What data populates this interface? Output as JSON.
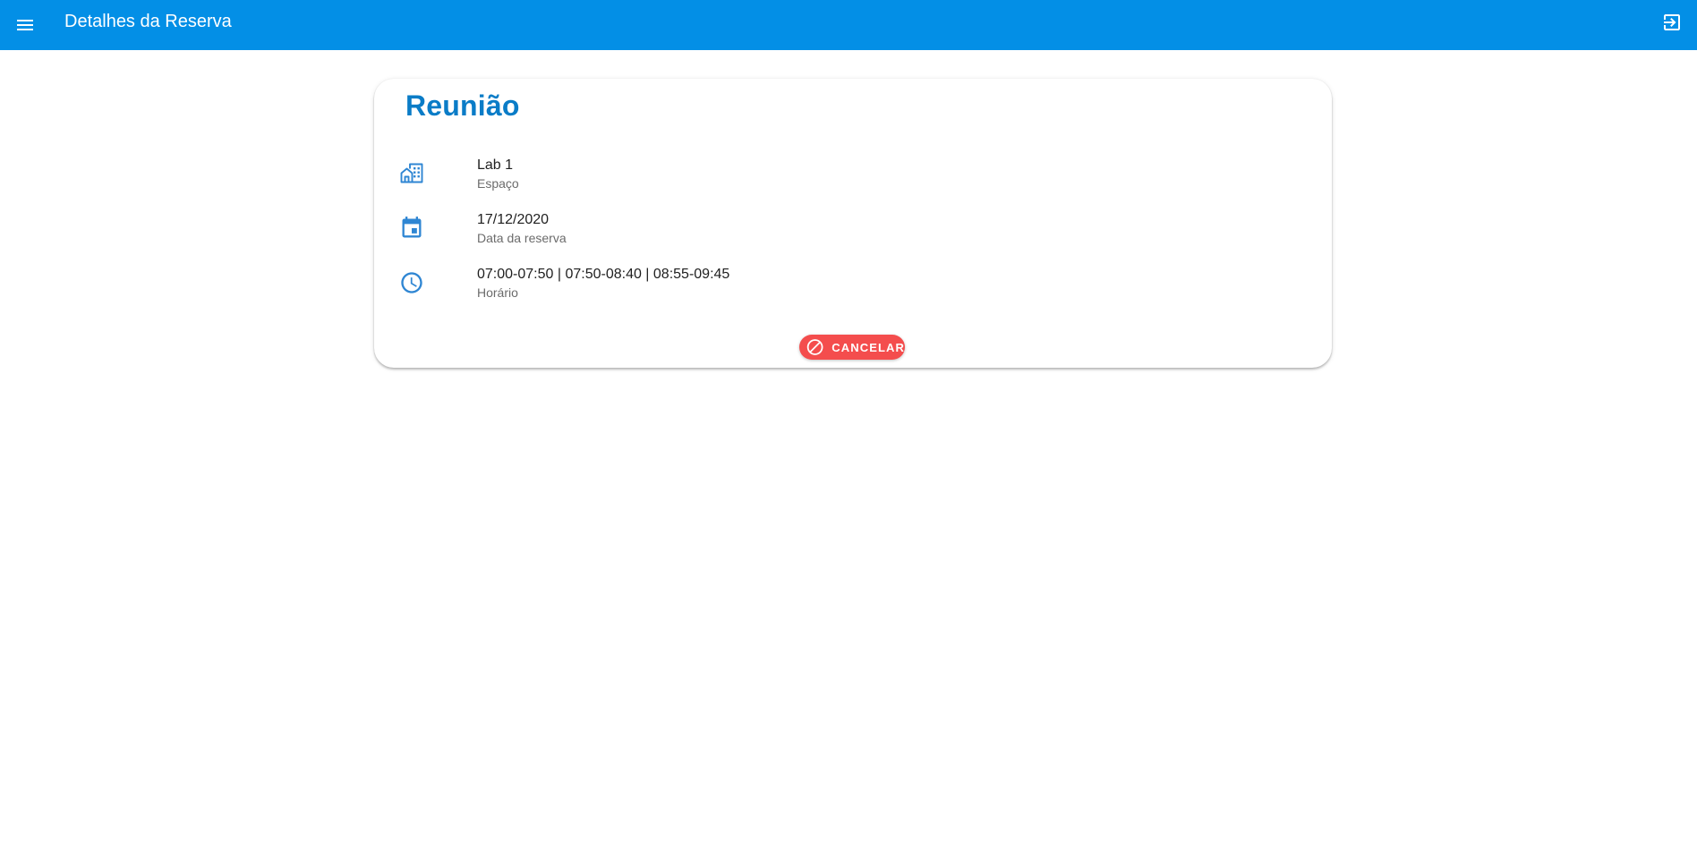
{
  "app_bar": {
    "title": "Detalhes da Reserva",
    "menu_icon": "menu-icon",
    "logout_icon": "logout-icon",
    "color": "#038FE6"
  },
  "reservation": {
    "title": "Reunião",
    "title_color": "#0A7CC7",
    "details": [
      {
        "icon": "building-icon",
        "value": "Lab 1",
        "label": "Espaço"
      },
      {
        "icon": "calendar-icon",
        "value": "17/12/2020",
        "label": "Data da reserva"
      },
      {
        "icon": "clock-icon",
        "value": "07:00-07:50 | 07:50-08:40 | 08:55-09:45",
        "label": "Horário"
      }
    ],
    "cancel_button": {
      "label": "CANCELAR",
      "icon": "block-icon",
      "color": "#F44D4D"
    }
  }
}
